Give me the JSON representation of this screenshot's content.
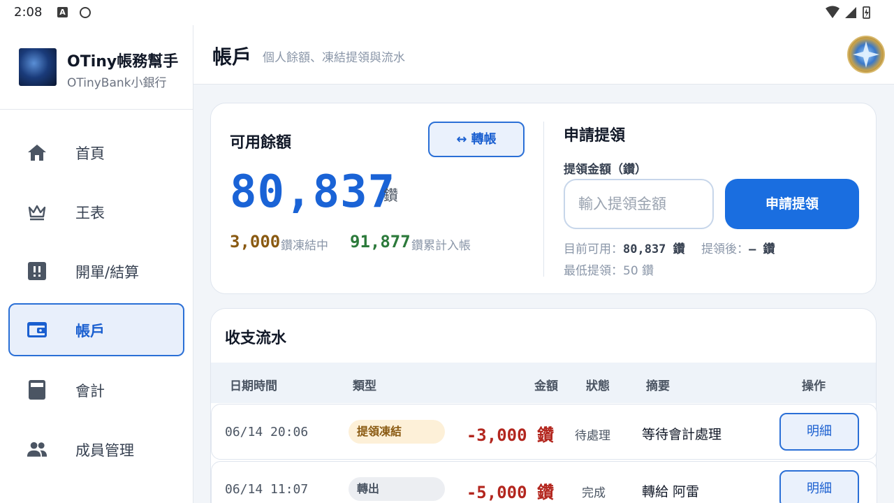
{
  "status_bar": {
    "time": "2:08",
    "a_badge": "A"
  },
  "brand": {
    "title": "OTiny帳務幫手",
    "subtitle": "OTinyBank小銀行"
  },
  "nav": [
    {
      "label": "首頁",
      "icon": "home-icon"
    },
    {
      "label": "王表",
      "icon": "crown-icon"
    },
    {
      "label": "開單/結算",
      "icon": "alert-box-icon"
    },
    {
      "label": "帳戶",
      "icon": "wallet-icon",
      "active": true
    },
    {
      "label": "會計",
      "icon": "calculator-icon"
    },
    {
      "label": "成員管理",
      "icon": "people-icon"
    }
  ],
  "header": {
    "title": "帳戶",
    "subtitle": "個人餘額、凍結提領與流水"
  },
  "balance": {
    "title": "可用餘額",
    "transfer_label": "↔ 轉帳",
    "amount": "80,837",
    "unit": "鑽",
    "frozen_amount": "3,000",
    "frozen_label": "鑽凍結中",
    "total_amount": "91,877",
    "total_label": "鑽累計入帳"
  },
  "withdraw": {
    "title": "申請提領",
    "field_label": "提領金額（鑽）",
    "placeholder": "輸入提領金額",
    "button_label": "申請提領",
    "available_prefix": "目前可用：",
    "available_value": "80,837 鑽",
    "after_prefix": "提領後：",
    "after_value": "— 鑽",
    "min_text": "最低提領：50 鑽"
  },
  "ledger": {
    "title": "收支流水",
    "columns": [
      "日期時間",
      "類型",
      "金額",
      "狀態",
      "摘要",
      "操作"
    ],
    "rows": [
      {
        "date": "06/14 20:06",
        "type": "提領凍結",
        "amount": "-3,000 鑽",
        "status": "待處理",
        "memo": "等待會計處理",
        "action": "明細"
      },
      {
        "date": "06/14 11:07",
        "type": "轉出",
        "amount": "-5,000 鑽",
        "status": "完成",
        "memo": "轉給 阿雷",
        "action": "明細"
      }
    ]
  }
}
